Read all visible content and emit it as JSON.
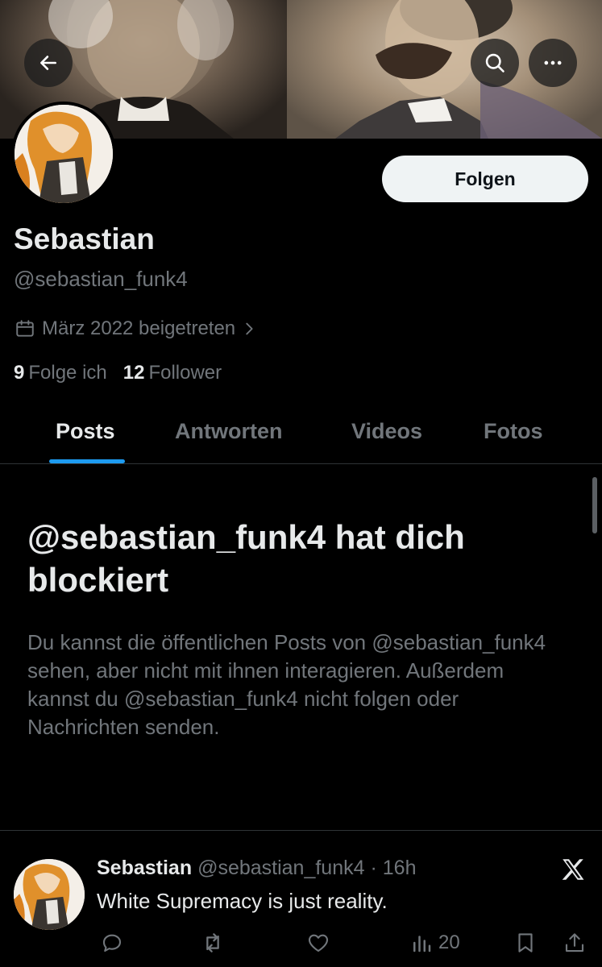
{
  "profile": {
    "name": "Sebastian",
    "handle": "@sebastian_funk4",
    "joined": "März 2022 beigetreten",
    "following_count": "9",
    "following_label": "Folge ich",
    "followers_count": "12",
    "followers_label": "Follower",
    "follow_button": "Folgen"
  },
  "tabs": [
    {
      "label": "Posts",
      "active": true
    },
    {
      "label": "Antworten",
      "active": false
    },
    {
      "label": "Videos",
      "active": false
    },
    {
      "label": "Fotos",
      "active": false
    }
  ],
  "blocked": {
    "title": "@sebastian_funk4 hat dich blockiert",
    "message": "Du kannst die öffentlichen Posts von @sebastian_funk4 sehen, aber nicht mit ihnen interagieren. Außerdem kannst du @sebastian_funk4 nicht folgen oder Nachrichten senden."
  },
  "tweet": {
    "name": "Sebastian",
    "handle": "@sebastian_funk4",
    "time": "· 16h",
    "text": "White Supremacy is just reality.",
    "views": "20"
  },
  "icons": {
    "back": "arrow-left-icon",
    "search": "search-icon",
    "more": "more-icon",
    "calendar": "calendar-icon",
    "chevron": "chevron-right-icon",
    "x_logo": "x-logo-icon",
    "reply": "reply-icon",
    "retweet": "retweet-icon",
    "like": "like-icon",
    "views": "views-icon",
    "bookmark": "bookmark-icon",
    "share": "share-icon"
  },
  "colors": {
    "background": "#000000",
    "accent": "#1d9bf0",
    "text_primary": "#e7e9ea",
    "text_secondary": "#71767b",
    "follow_button_bg": "#eff3f4"
  }
}
